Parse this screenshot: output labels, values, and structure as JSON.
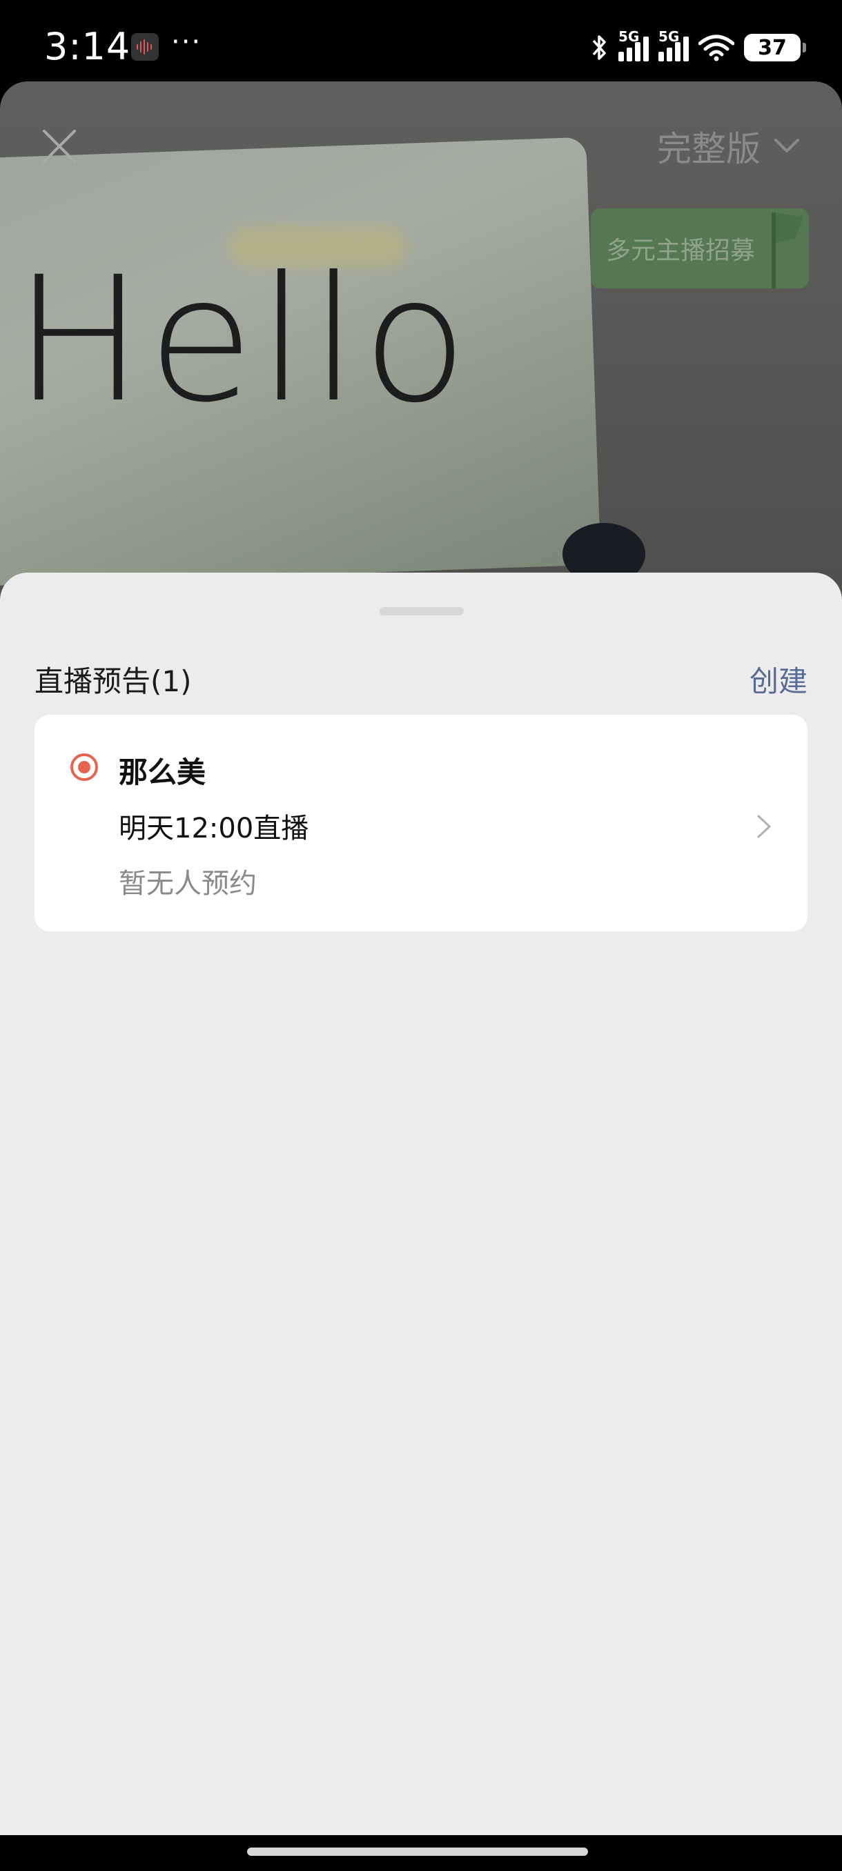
{
  "status_bar": {
    "time": "3:14",
    "more": "···",
    "signal_1": "5G",
    "signal_2": "5G",
    "battery": "37"
  },
  "video": {
    "paper_text": "Hello",
    "version_label": "完整版",
    "recruit_banner": "多元主播招募"
  },
  "sheet": {
    "title": "直播预告(1)",
    "create_label": "创建",
    "items": [
      {
        "name": "那么美",
        "time": "明天12:00直播",
        "reservations": "暂无人预约"
      }
    ]
  },
  "colors": {
    "accent_red": "#e8634f",
    "link_blue": "#576b95",
    "sheet_bg": "#ececec"
  }
}
